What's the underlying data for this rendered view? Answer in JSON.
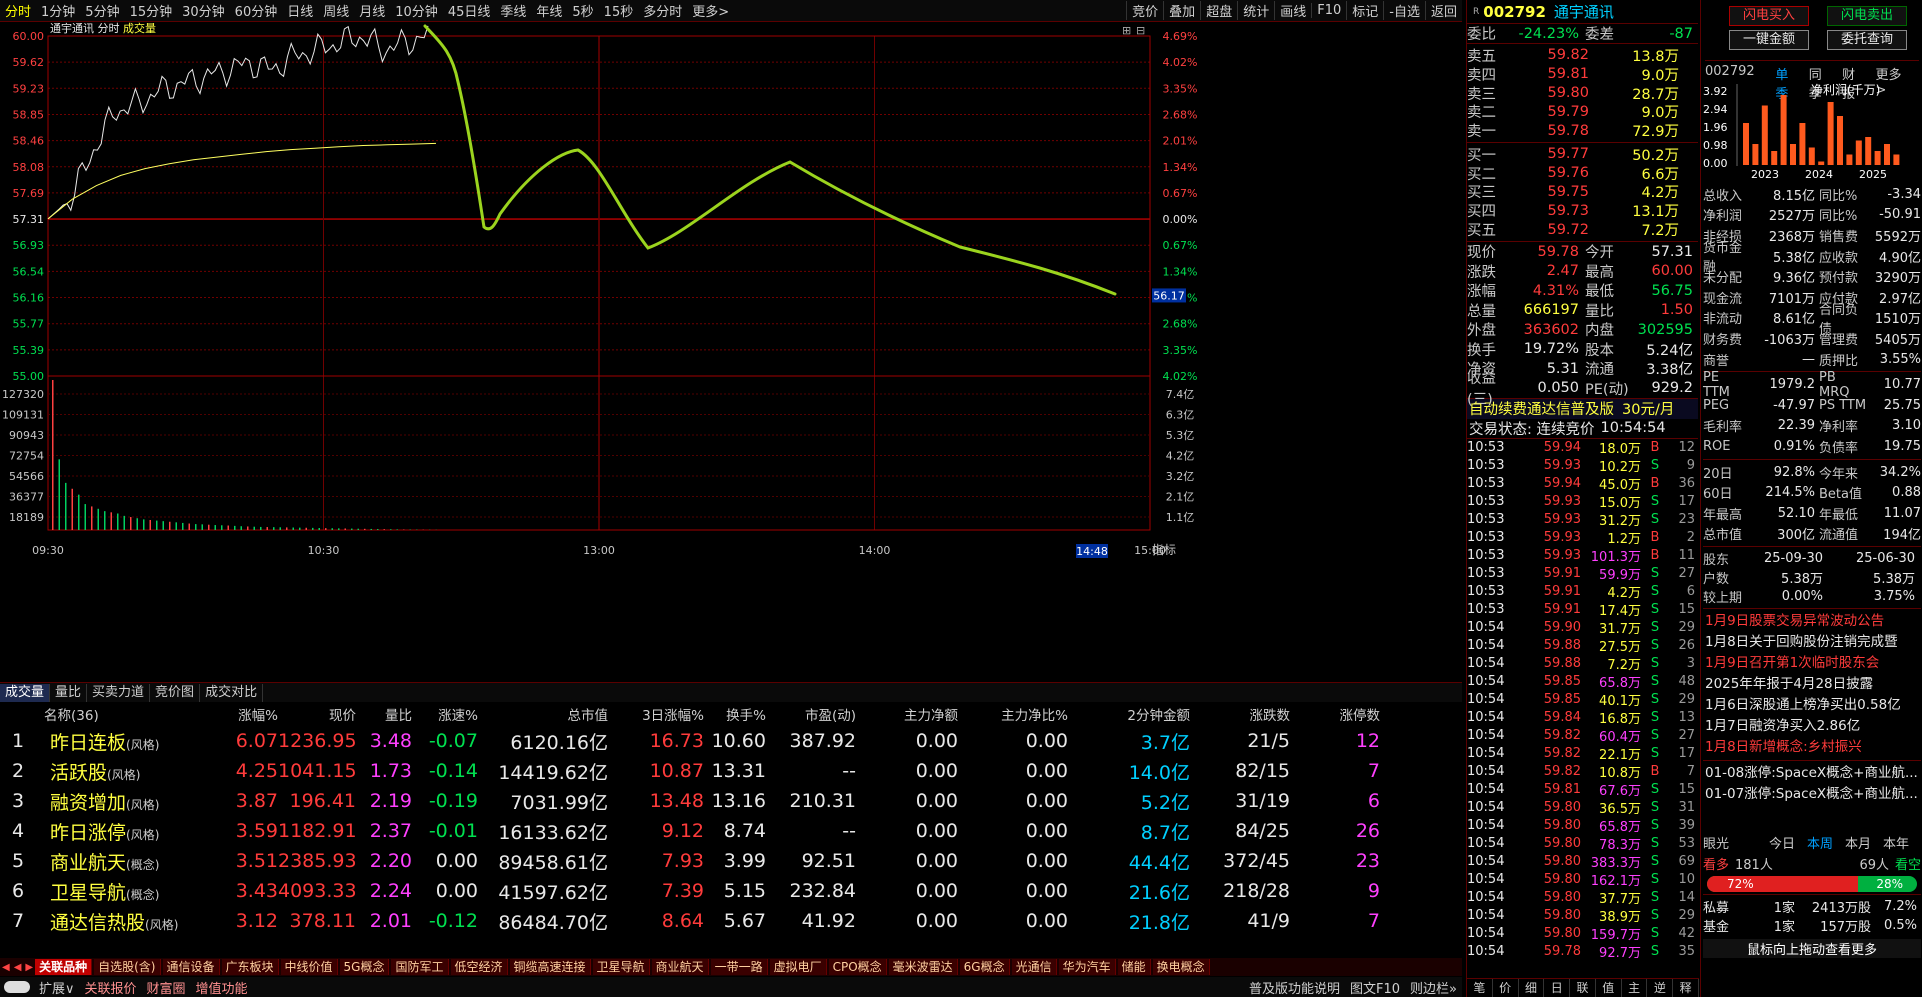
{
  "toolbar": {
    "periods": [
      "分时",
      "1分钟",
      "5分钟",
      "15分钟",
      "30分钟",
      "60分钟",
      "日线",
      "周线",
      "月线",
      "10分钟",
      "45日线",
      "季线",
      "年线",
      "5秒",
      "15秒",
      "多分时",
      "更多>"
    ],
    "active": 0,
    "right_tools": [
      "竞价",
      "叠加",
      "超盘",
      "统计",
      "画线",
      "F10",
      "标记",
      "-自选",
      "返回"
    ]
  },
  "chart": {
    "name": "通宇通讯",
    "mode": "分时",
    "volume_label": "成交量",
    "price_ticks": [
      "60.00",
      "59.62",
      "59.23",
      "58.85",
      "58.46",
      "58.08",
      "57.69",
      "57.31",
      "56.93",
      "56.54",
      "56.16",
      "55.77",
      "55.39",
      "55.00"
    ],
    "pct_ticks": [
      "4.69%",
      "4.02%",
      "3.35%",
      "2.68%",
      "2.01%",
      "1.34%",
      "0.67%",
      "0.00%",
      "0.67%",
      "1.34%",
      "2.01%",
      "2.68%",
      "3.35%",
      "4.02%"
    ],
    "vol_ticks": [
      "127320",
      "109131",
      "90943",
      "72754",
      "54566",
      "36377",
      "18189"
    ],
    "amt_ticks": [
      "7.4亿",
      "6.3亿",
      "5.3亿",
      "4.2亿",
      "3.2亿",
      "2.1亿",
      "1.1亿"
    ],
    "time_ticks": [
      "09:30",
      "10:30",
      "13:00",
      "14:00",
      "15:00"
    ],
    "cursor_price": "56.17",
    "cursor_time": "14:48",
    "prev_close": 57.31,
    "price_max": 60.0,
    "price_min": 55.0,
    "vol_max": 127320,
    "indicator_label": "指标"
  },
  "chart_data": {
    "type": "line",
    "title": "通宇通讯 分时",
    "xlabel": "",
    "ylabel": "",
    "ylim": [
      55.0,
      60.0
    ],
    "series": [
      {
        "values": [
          57.31,
          57.6,
          58.3,
          58.9,
          59.0,
          59.2,
          59.3,
          59.4,
          59.5,
          59.6,
          59.5,
          59.7,
          59.8,
          59.9,
          60.0,
          59.8,
          59.9,
          60.0
        ]
      },
      {
        "values": [
          57.31,
          57.6,
          57.8,
          57.95,
          58.05,
          58.12,
          58.18,
          58.22,
          58.26,
          58.3,
          58.33,
          58.35,
          58.37,
          58.39,
          58.4,
          58.41,
          58.42
        ]
      }
    ],
    "volume": [
      127320,
      60000,
      40000,
      35000,
      30000,
      22000,
      20000,
      18000,
      16000,
      15000,
      14000,
      12000,
      11000,
      10000,
      9000,
      8500,
      8000,
      7500,
      7000,
      6500,
      6000,
      5500,
      5000,
      4800,
      4500,
      4200,
      4000,
      3800,
      3500,
      3200,
      3000,
      2800,
      2600,
      2500,
      2400,
      2300,
      2200,
      2100,
      2000,
      1900,
      1800,
      1700,
      1600,
      1500,
      1400,
      1300,
      1200,
      1100,
      1000,
      900,
      800,
      700,
      600,
      500,
      400,
      350,
      300,
      250,
      200,
      150
    ]
  },
  "subtabs": [
    "成交量",
    "量比",
    "买卖力道",
    "竞价图",
    "成交对比"
  ],
  "table": {
    "columns": [
      "",
      "名称(36)",
      "涨幅%",
      "现价",
      "量比",
      "涨速%",
      "总市值",
      "3日涨幅%",
      "换手%",
      "市盈(动)",
      "主力净额",
      "主力净比%",
      "2分钟金额",
      "涨跌数",
      "涨停数"
    ],
    "rows": [
      {
        "idx": "1",
        "name": "昨日连板",
        "tag": "(风格)",
        "chg": "6.07",
        "price": "1236.95",
        "vr": "3.48",
        "spd": "-0.07",
        "cap": "6120.16亿",
        "chg3": "16.73",
        "turn": "10.60",
        "pe": "387.92",
        "net": "0.00",
        "netp": "0.00",
        "amt2": "3.7亿",
        "ud": "21/5",
        "zt": "12"
      },
      {
        "idx": "2",
        "name": "活跃股",
        "tag": "(风格)",
        "chg": "4.25",
        "price": "1041.15",
        "vr": "1.73",
        "spd": "-0.14",
        "cap": "14419.62亿",
        "chg3": "10.87",
        "turn": "13.31",
        "pe": "--",
        "net": "0.00",
        "netp": "0.00",
        "amt2": "14.0亿",
        "ud": "82/15",
        "zt": "7"
      },
      {
        "idx": "3",
        "name": "融资增加",
        "tag": "(风格)",
        "chg": "3.87",
        "price": "196.41",
        "vr": "2.19",
        "spd": "-0.19",
        "cap": "7031.99亿",
        "chg3": "13.48",
        "turn": "13.16",
        "pe": "210.31",
        "net": "0.00",
        "netp": "0.00",
        "amt2": "5.2亿",
        "ud": "31/19",
        "zt": "6"
      },
      {
        "idx": "4",
        "name": "昨日涨停",
        "tag": "(风格)",
        "chg": "3.59",
        "price": "1182.91",
        "vr": "2.37",
        "spd": "-0.01",
        "cap": "16133.62亿",
        "chg3": "9.12",
        "turn": "8.74",
        "pe": "--",
        "net": "0.00",
        "netp": "0.00",
        "amt2": "8.7亿",
        "ud": "84/25",
        "zt": "26"
      },
      {
        "idx": "5",
        "name": "商业航天",
        "tag": "(概念)",
        "chg": "3.51",
        "price": "2385.93",
        "vr": "2.20",
        "spd": "0.00",
        "cap": "89458.61亿",
        "chg3": "7.93",
        "turn": "3.99",
        "pe": "92.51",
        "net": "0.00",
        "netp": "0.00",
        "amt2": "44.4亿",
        "ud": "372/45",
        "zt": "23"
      },
      {
        "idx": "6",
        "name": "卫星导航",
        "tag": "(概念)",
        "chg": "3.43",
        "price": "4093.33",
        "vr": "2.24",
        "spd": "0.00",
        "cap": "41597.62亿",
        "chg3": "7.39",
        "turn": "5.15",
        "pe": "232.84",
        "net": "0.00",
        "netp": "0.00",
        "amt2": "21.6亿",
        "ud": "218/28",
        "zt": "9"
      },
      {
        "idx": "7",
        "name": "通达信热股",
        "tag": "(风格)",
        "chg": "3.12",
        "price": "378.11",
        "vr": "2.01",
        "spd": "-0.12",
        "cap": "86484.70亿",
        "chg3": "8.64",
        "turn": "5.67",
        "pe": "41.92",
        "net": "0.00",
        "netp": "0.00",
        "amt2": "21.8亿",
        "ud": "41/9",
        "zt": "7"
      }
    ]
  },
  "sectors": [
    "关联品种",
    "自选股(含)",
    "通信设备",
    "广东板块",
    "中线价值",
    "5G概念",
    "国防军工",
    "低空经济",
    "铜缆高速连接",
    "卫星导航",
    "商业航天",
    "一带一路",
    "虚拟电厂",
    "CPO概念",
    "毫米波雷达",
    "6G概念",
    "光通信",
    "华为汽车",
    "储能",
    "换电概念"
  ],
  "bottom": {
    "items": [
      "扩展∨",
      "关联报价",
      "财富圈",
      "增值功能"
    ],
    "right": [
      "普及版功能说明",
      "图文F10",
      "则边栏»"
    ]
  },
  "quote": {
    "code": "002792",
    "name": "通宇通讯",
    "weibi_label": "委比",
    "weibi": "-24.23%",
    "weicha_label": "委差",
    "weicha": "-87",
    "asks": [
      {
        "l": "卖五",
        "p": "59.82",
        "v": "13.8万"
      },
      {
        "l": "卖四",
        "p": "59.81",
        "v": "9.0万"
      },
      {
        "l": "卖三",
        "p": "59.80",
        "v": "28.7万"
      },
      {
        "l": "卖二",
        "p": "59.79",
        "v": "9.0万"
      },
      {
        "l": "卖一",
        "p": "59.78",
        "v": "72.9万"
      }
    ],
    "bids": [
      {
        "l": "买一",
        "p": "59.77",
        "v": "50.2万"
      },
      {
        "l": "买二",
        "p": "59.76",
        "v": "6.6万"
      },
      {
        "l": "买三",
        "p": "59.75",
        "v": "4.2万"
      },
      {
        "l": "买四",
        "p": "59.73",
        "v": "13.1万"
      },
      {
        "l": "买五",
        "p": "59.72",
        "v": "7.2万"
      }
    ],
    "stats": [
      [
        "现价",
        "59.78",
        "今开",
        "57.31"
      ],
      [
        "涨跌",
        "2.47",
        "最高",
        "60.00"
      ],
      [
        "涨幅",
        "4.31%",
        "最低",
        "56.75"
      ],
      [
        "总量",
        "666197",
        "量比",
        "1.50"
      ],
      [
        "外盘",
        "363602",
        "内盘",
        "302595"
      ],
      [
        "换手",
        "19.72%",
        "股本",
        "5.24亿"
      ],
      [
        "净资",
        "5.31",
        "流通",
        "3.38亿"
      ],
      [
        "收益(三)",
        "0.050",
        "PE(动)",
        "929.2"
      ]
    ],
    "promo": "自动续费通达信普及版",
    "promo_price": "30元/月",
    "status": "交易状态: 连续竞价",
    "status_time": "10:54:54",
    "ticks": [
      [
        "10:53",
        "59.94",
        "18.0万",
        "B",
        "12"
      ],
      [
        "10:53",
        "59.93",
        "10.2万",
        "S",
        "9"
      ],
      [
        "10:53",
        "59.94",
        "45.0万",
        "B",
        "36"
      ],
      [
        "10:53",
        "59.93",
        "15.0万",
        "S",
        "17"
      ],
      [
        "10:53",
        "59.93",
        "31.2万",
        "S",
        "23"
      ],
      [
        "10:53",
        "59.93",
        "1.2万",
        "B",
        "2"
      ],
      [
        "10:53",
        "59.93",
        "101.3万",
        "B",
        "11"
      ],
      [
        "10:53",
        "59.91",
        "59.9万",
        "S",
        "27"
      ],
      [
        "10:53",
        "59.91",
        "4.2万",
        "S",
        "6"
      ],
      [
        "10:53",
        "59.91",
        "17.4万",
        "S",
        "15"
      ],
      [
        "10:54",
        "59.90",
        "31.7万",
        "S",
        "29"
      ],
      [
        "10:54",
        "59.88",
        "27.5万",
        "S",
        "26"
      ],
      [
        "10:54",
        "59.88",
        "7.2万",
        "S",
        "3"
      ],
      [
        "10:54",
        "59.85",
        "65.8万",
        "S",
        "48"
      ],
      [
        "10:54",
        "59.85",
        "40.1万",
        "S",
        "29"
      ],
      [
        "10:54",
        "59.84",
        "16.8万",
        "S",
        "13"
      ],
      [
        "10:54",
        "59.82",
        "60.4万",
        "S",
        "27"
      ],
      [
        "10:54",
        "59.82",
        "22.1万",
        "S",
        "17"
      ],
      [
        "10:54",
        "59.82",
        "10.8万",
        "B",
        "7"
      ],
      [
        "10:54",
        "59.81",
        "67.6万",
        "S",
        "15"
      ],
      [
        "10:54",
        "59.80",
        "36.5万",
        "S",
        "31"
      ],
      [
        "10:54",
        "59.80",
        "65.8万",
        "S",
        "39"
      ],
      [
        "10:54",
        "59.80",
        "78.3万",
        "S",
        "53"
      ],
      [
        "10:54",
        "59.80",
        "383.3万",
        "S",
        "69"
      ],
      [
        "10:54",
        "59.80",
        "162.1万",
        "S",
        "10"
      ],
      [
        "10:54",
        "59.80",
        "37.7万",
        "S",
        "14"
      ],
      [
        "10:54",
        "59.80",
        "38.9万",
        "S",
        "29"
      ],
      [
        "10:54",
        "59.80",
        "159.7万",
        "S",
        "42"
      ],
      [
        "10:54",
        "59.78",
        "92.7万",
        "S",
        "35"
      ]
    ],
    "bottom_tabs": [
      "笔",
      "价",
      "细",
      "日",
      "联",
      "值",
      "主",
      "逆",
      "释"
    ]
  },
  "fin": {
    "buttons": [
      "闪电买入",
      "闪电卖出",
      "一键金额",
      "委托查询"
    ],
    "code": "002792",
    "tabs": [
      "单季",
      "同季",
      "财报",
      "更多>"
    ],
    "metric": "净利润(千万)",
    "yticks": [
      "3.92",
      "2.94",
      "1.96",
      "0.98",
      "0.00"
    ],
    "years": [
      "2023",
      "2024",
      "2025"
    ],
    "bars": [
      0.6,
      0.3,
      0.85,
      0.2,
      1.0,
      0.3,
      0.6,
      0.25,
      0.05,
      0.9,
      0.7,
      0.15,
      0.35,
      0.4,
      0.2,
      0.3,
      0.15
    ],
    "rows": [
      [
        "总收入",
        "8.15亿",
        "同比%",
        "-3.34"
      ],
      [
        "净利润",
        "2527万",
        "同比%",
        "-50.91"
      ],
      [
        "非经损",
        "2368万",
        "销售费",
        "5592万"
      ],
      [
        "货币金融",
        "5.38亿",
        "应收款",
        "4.90亿"
      ],
      [
        "未分配",
        "9.36亿",
        "预付款",
        "3290万"
      ],
      [
        "现金流",
        "7101万",
        "应付款",
        "2.97亿"
      ],
      [
        "非流动",
        "8.61亿",
        "合同负债",
        "1510万"
      ],
      [
        "财务费",
        "-1063万",
        "管理费",
        "5405万"
      ],
      [
        "商誉",
        "—",
        "质押比",
        "3.55%"
      ]
    ],
    "rows2": [
      [
        "PE TTM",
        "1979.2",
        "PB MRQ",
        "10.77"
      ],
      [
        "PEG",
        "-47.97",
        "PS TTM",
        "25.75"
      ],
      [
        "毛利率",
        "22.39",
        "净利率",
        "3.10"
      ],
      [
        "ROE",
        "0.91%",
        "负债率",
        "19.75"
      ]
    ],
    "rows3": [
      [
        "20日",
        "92.8%",
        "今年来",
        "34.2%"
      ],
      [
        "60日",
        "214.5%",
        "Beta值",
        "0.88"
      ],
      [
        "年最高",
        "52.10",
        "年最低",
        "11.07"
      ],
      [
        "总市值",
        "300亿",
        "流通值",
        "194亿"
      ]
    ],
    "holders": [
      [
        "股东",
        "25-09-30",
        "25-06-30"
      ],
      [
        "户数",
        "5.38万",
        "5.38万"
      ],
      [
        "较上期",
        "0.00%",
        "3.75%"
      ]
    ],
    "news": [
      {
        "t": "1月9日股票交易异常波动公告",
        "c": "red"
      },
      {
        "t": "1月8日关于回购股份注销完成暨",
        "c": "white"
      },
      {
        "t": "1月9日召开第1次临时股东会",
        "c": "red"
      },
      {
        "t": "2025年年报于4月28日披露",
        "c": "white"
      },
      {
        "t": "1月6日深股通上榜净买出0.58亿",
        "c": "white"
      },
      {
        "t": "1月7日融资净买入2.86亿",
        "c": "white"
      },
      {
        "t": "1月8日新增概念:乡村振兴",
        "c": "red"
      }
    ],
    "news2": [
      "01-08涨停:SpaceX概念+商业航...",
      "01-07涨停:SpaceX概念+商业航..."
    ],
    "eye": {
      "label": "眼光",
      "tabs": [
        "今日",
        "本周",
        "本月",
        "本年"
      ],
      "bull": "看多",
      "bull_n": "181人",
      "bear_n": "69人",
      "bear": "看空",
      "bull_pct": "72%",
      "bear_pct": "28%",
      "bull_frac": 0.72
    },
    "fund": [
      [
        "私募",
        "1家",
        "2413万股",
        "7.2%"
      ],
      [
        "基金",
        "1家",
        "157万股",
        "0.5%"
      ]
    ],
    "hint": "鼠标向上拖动查看更多"
  }
}
